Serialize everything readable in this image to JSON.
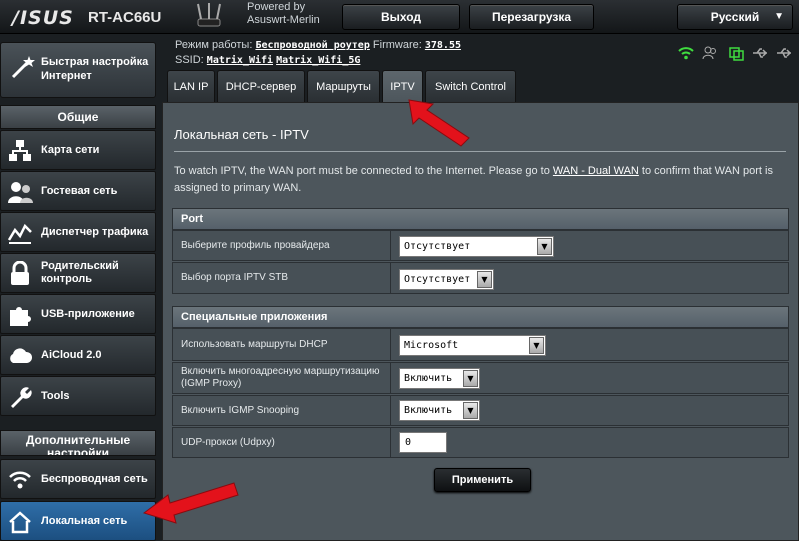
{
  "header": {
    "brand": "/ISUS",
    "model": "RT-AC66U",
    "powered_by_1": "Powered by",
    "powered_by_2": "Asuswrt-Merlin",
    "logout": "Выход",
    "reboot": "Перезагрузка",
    "language": "Русский"
  },
  "status": {
    "mode_label": "Режим работы:",
    "mode_value": "Беспроводной роутер",
    "firmware_label": "Firmware:",
    "firmware_value": "378.55",
    "ssid_label": "SSID:",
    "ssid_1": "Matrix_Wifi",
    "ssid_2": "Matrix_Wifi_5G"
  },
  "sidebar": {
    "quick_setup": "Быстрая настройка Интернет",
    "general_header": "Общие",
    "items": [
      {
        "label": "Карта сети",
        "icon": "network-map-icon"
      },
      {
        "label": "Гостевая сеть",
        "icon": "guest-network-icon"
      },
      {
        "label": "Диспетчер трафика",
        "icon": "traffic-manager-icon"
      },
      {
        "label": "Родительский контроль",
        "icon": "parental-lock-icon"
      },
      {
        "label": "USB-приложение",
        "icon": "usb-puzzle-icon"
      },
      {
        "label": "AiCloud 2.0",
        "icon": "aicloud-icon"
      },
      {
        "label": "Tools",
        "icon": "tools-wrench-icon"
      }
    ],
    "advanced_header": "Дополнительные настройки",
    "advanced_items": [
      {
        "label": "Беспроводная сеть",
        "icon": "wireless-icon"
      },
      {
        "label": "Локальная сеть",
        "icon": "lan-home-icon"
      }
    ]
  },
  "tabs": [
    {
      "label": "LAN IP"
    },
    {
      "label": "DHCP-сервер"
    },
    {
      "label": "Маршруты"
    },
    {
      "label": "IPTV"
    },
    {
      "label": "Switch Control"
    }
  ],
  "main": {
    "title": "Локальная сеть - IPTV",
    "desc_1": "To watch IPTV, the WAN port must be connected to the Internet. Please go to ",
    "desc_link": "WAN - Dual WAN",
    "desc_2": " to confirm that WAN port is assigned to primary WAN.",
    "section_port": "Port",
    "provider_label": "Выберите профиль провайдера",
    "provider_value": "Отсутствует",
    "stb_label": "Выбор порта IPTV STB",
    "stb_value": "Отсутствует",
    "section_special": "Специальные приложения",
    "dhcp_routes_label": "Использовать маршруты DHCP",
    "dhcp_routes_value": "Microsoft",
    "igmp_proxy_label": "Включить многоадресную маршрутизацию (IGMP Proxy)",
    "igmp_proxy_value": "Включить",
    "igmp_snoop_label": "Включить IGMP Snooping",
    "igmp_snoop_value": "Включить",
    "udpxy_label": "UDP-прокси (Udpxy)",
    "udpxy_value": "0",
    "apply": "Применить"
  },
  "colors": {
    "annotation_arrow": "#e3121b",
    "active_item": "#2f6ea8",
    "status_green": "#3fdc3f"
  }
}
